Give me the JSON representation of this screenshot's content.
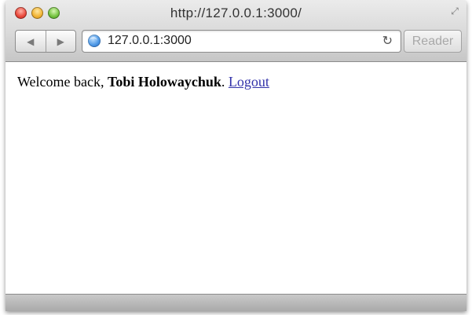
{
  "window": {
    "title": "http://127.0.0.1:3000/"
  },
  "toolbar": {
    "back_label": "◀",
    "forward_label": "▶",
    "url": "127.0.0.1:3000",
    "reload_label": "↻",
    "reader_label": "Reader",
    "fullscreen_label": "⤢"
  },
  "page": {
    "greeting": "Welcome back,",
    "username": "Tobi Holowaychuk",
    "separator": ".",
    "logout_label": "Logout"
  },
  "colors": {
    "link": "#3333aa",
    "close": "#e9473a",
    "minimize": "#f1b333",
    "zoom": "#73c33e"
  }
}
